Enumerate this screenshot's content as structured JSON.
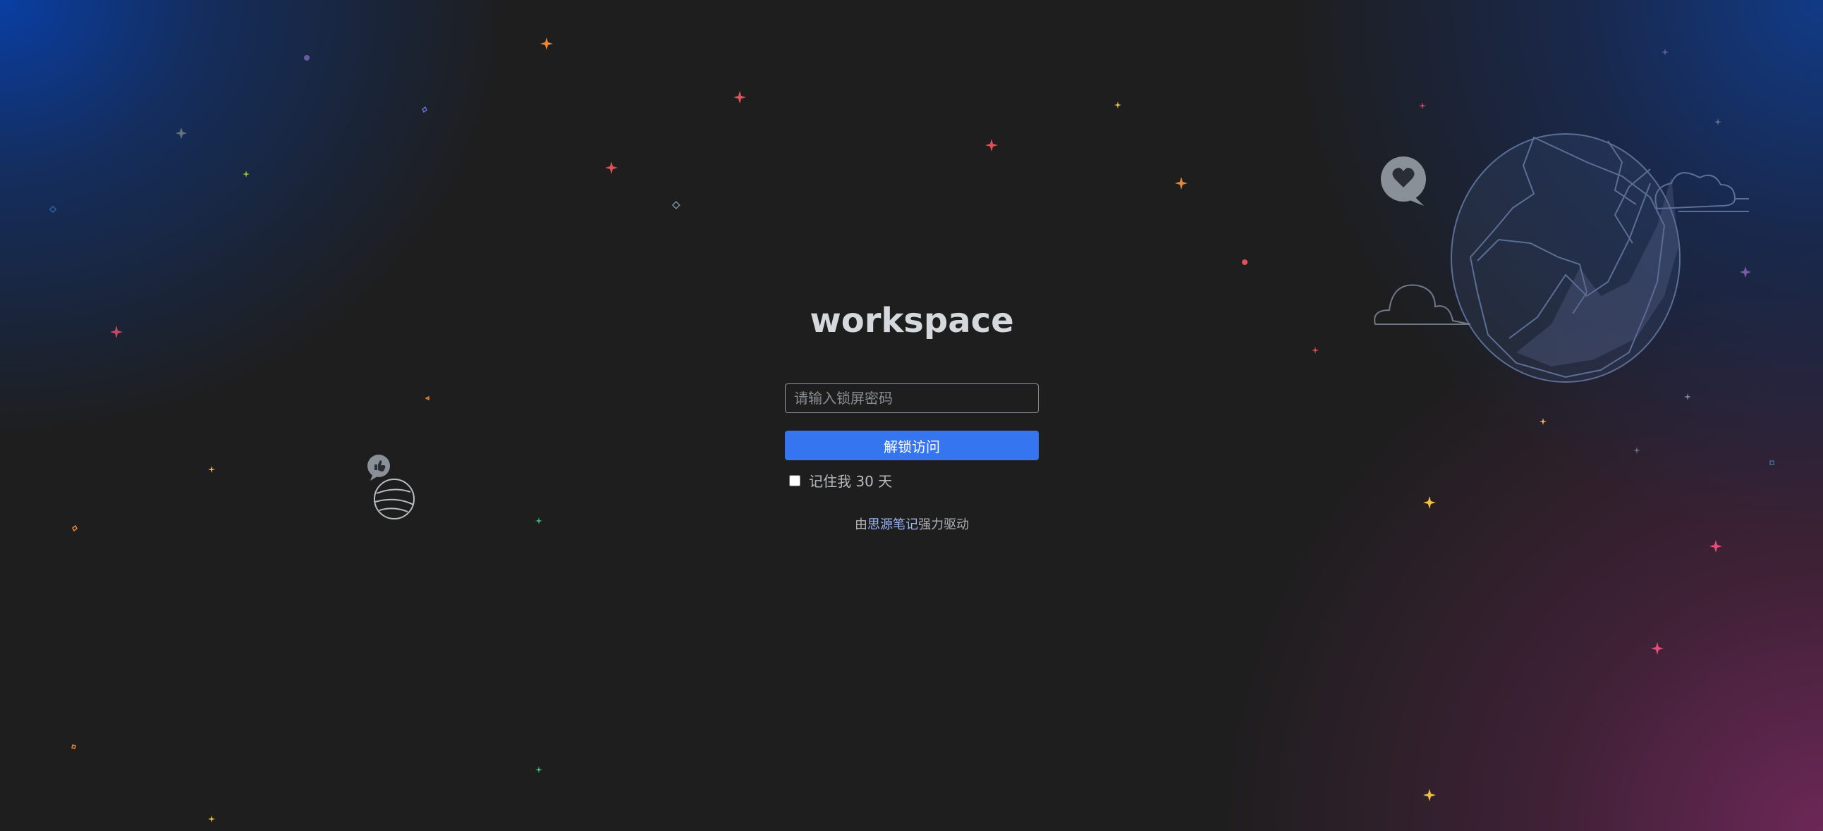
{
  "app_title": "workspace",
  "password": {
    "placeholder": "请输入锁屏密码",
    "value": ""
  },
  "unlock_button": "解锁访问",
  "remember": {
    "label": "记住我 30 天",
    "checked": false
  },
  "footer": {
    "prefix": "由",
    "link": "思源笔记",
    "suffix": "强力驱动"
  },
  "colors": {
    "background": "#1e1e1e",
    "accent": "#3575f0",
    "title": "#d5d8dc"
  },
  "decorations": [
    "globe-illustration",
    "heart-bubble-icon",
    "thumbs-up-bubble-icon",
    "planet-icon",
    "cloud-icon",
    "star-sparkle-icon"
  ]
}
